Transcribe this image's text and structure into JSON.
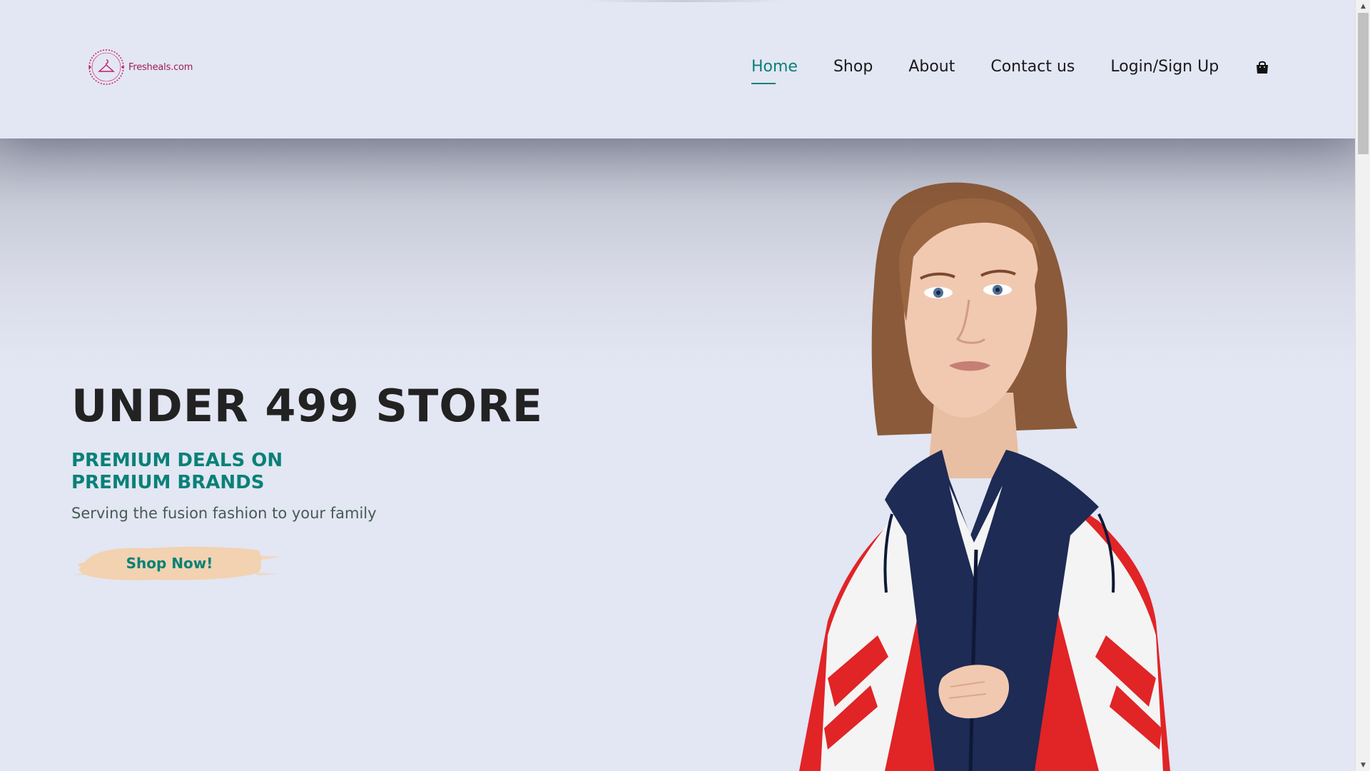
{
  "brand": {
    "logo_text": "Fresheals.com",
    "logo_ring_text": "Fresheals.com",
    "primary_color": "#088178",
    "logo_color": "#c8186b"
  },
  "nav": {
    "items": [
      {
        "label": "Home",
        "active": true
      },
      {
        "label": "Shop",
        "active": false
      },
      {
        "label": "About",
        "active": false
      },
      {
        "label": "Contact us",
        "active": false
      },
      {
        "label": "Login/Sign Up",
        "active": false
      }
    ],
    "cart_icon": "shopping-bag-icon"
  },
  "hero": {
    "title": "UNDER 499 STORE",
    "subtitle_line1": "PREMIUM DEALS ON",
    "subtitle_line2": "PREMIUM BRANDS",
    "tagline": "Serving the fusion fashion to your family",
    "cta_label": "Shop Now!",
    "cta_bg_color": "#f2d2b0"
  },
  "scrollbar": {
    "up_icon": "scroll-up-arrow-icon",
    "down_icon": "scroll-down-arrow-icon"
  }
}
